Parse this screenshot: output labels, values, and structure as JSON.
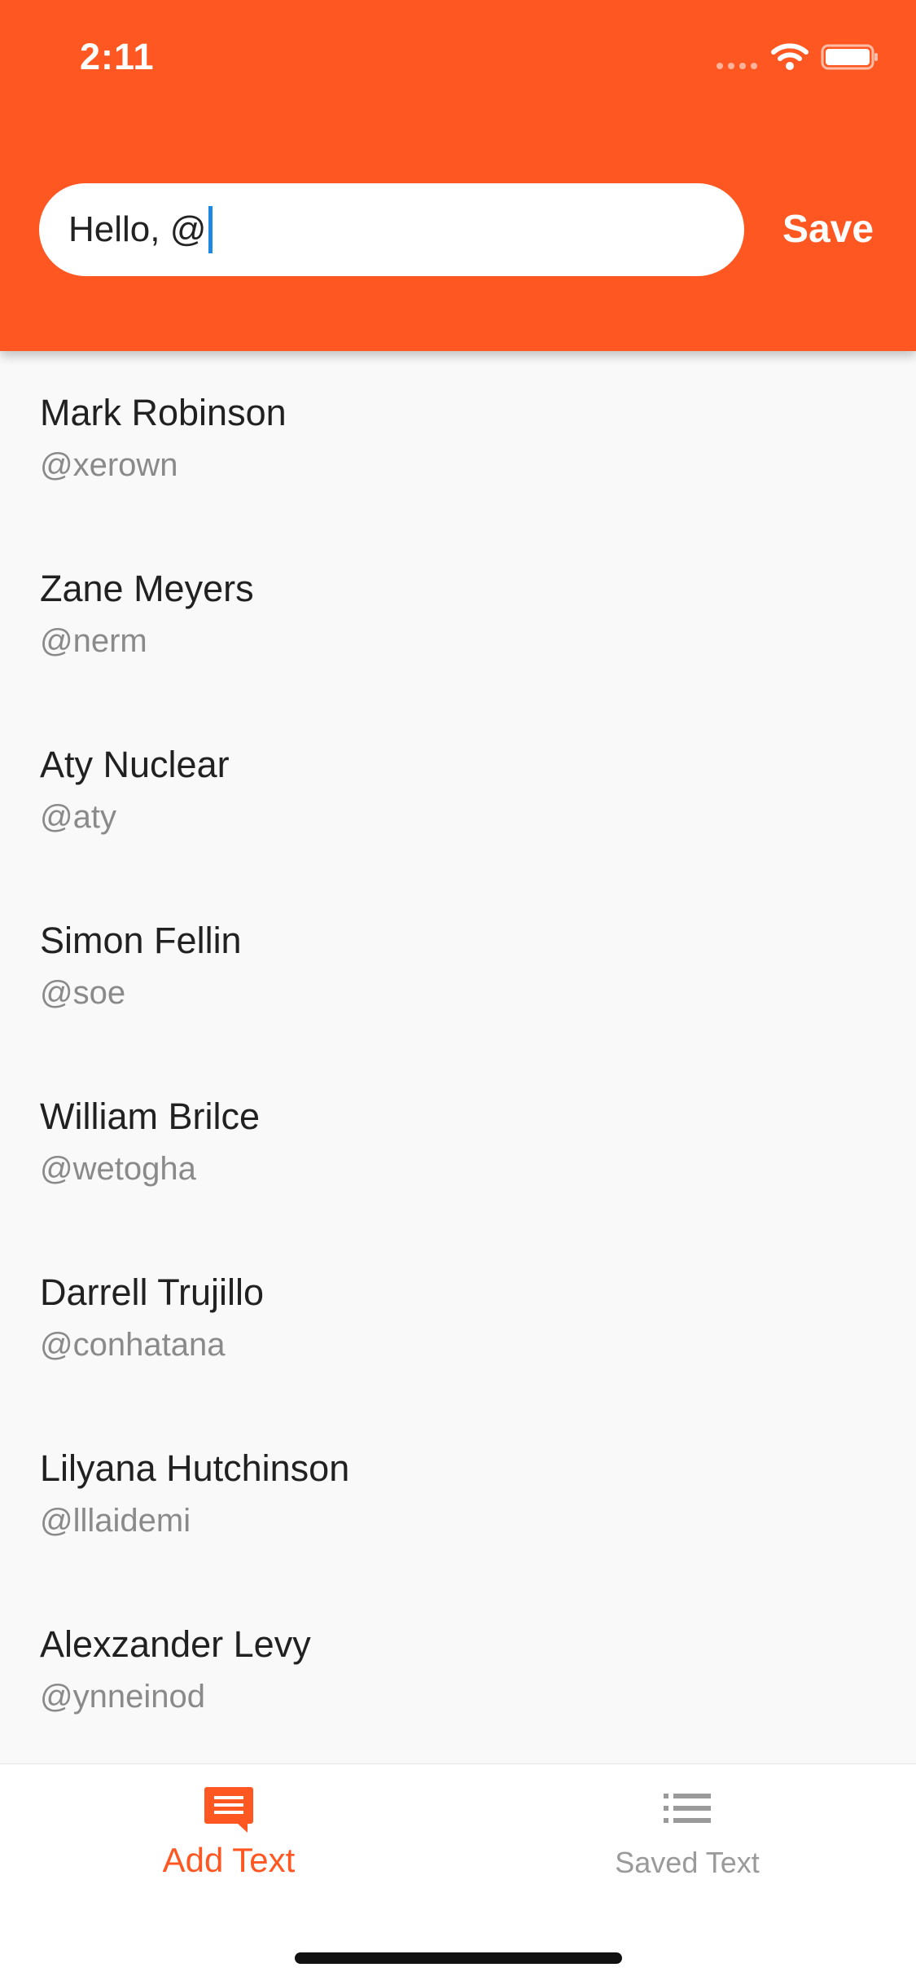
{
  "status_bar": {
    "time": "2:11"
  },
  "search": {
    "value": "Hello, @"
  },
  "header": {
    "save_label": "Save"
  },
  "users": [
    {
      "name": "Mark Robinson",
      "handle": "@xerown"
    },
    {
      "name": "Zane Meyers",
      "handle": "@nerm"
    },
    {
      "name": "Aty Nuclear",
      "handle": "@aty"
    },
    {
      "name": "Simon Fellin",
      "handle": "@soe"
    },
    {
      "name": "William Brilce",
      "handle": "@wetogha"
    },
    {
      "name": "Darrell Trujillo",
      "handle": "@conhatana"
    },
    {
      "name": "Lilyana Hutchinson",
      "handle": "@lllaidemi"
    },
    {
      "name": "Alexzander Levy",
      "handle": "@ynneinod"
    }
  ],
  "bottom_nav": {
    "items": [
      {
        "label": "Add Text",
        "icon": "message-icon",
        "active": true
      },
      {
        "label": "Saved Text",
        "icon": "list-icon",
        "active": false
      }
    ]
  },
  "colors": {
    "accent": "#ff5722",
    "caret": "#1e88e5",
    "inactive": "#9a9a9a"
  }
}
